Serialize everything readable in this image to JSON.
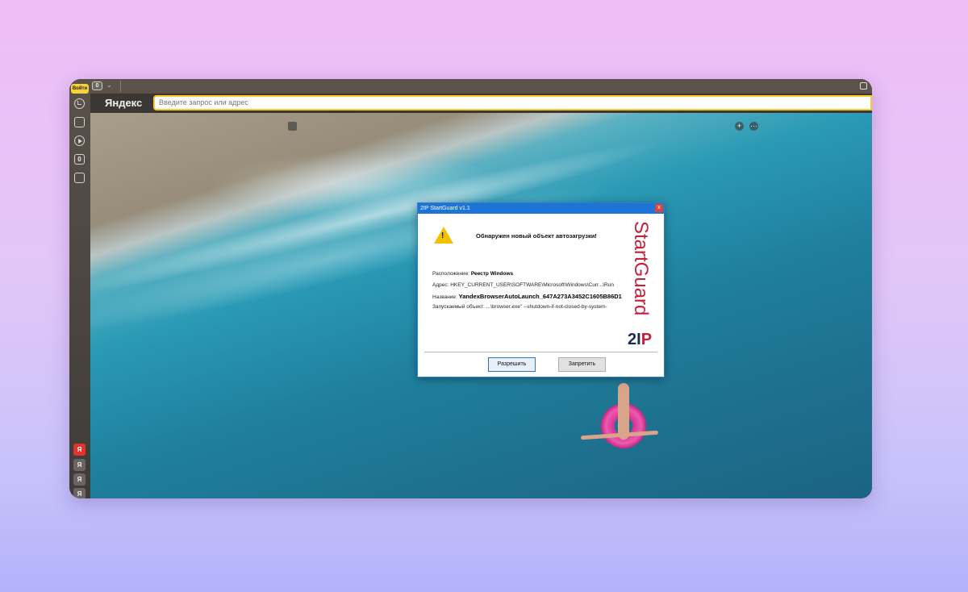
{
  "sidebar": {
    "login_label": "Войти",
    "icons": [
      "history-icon",
      "collections-icon",
      "video-icon",
      "counter-icon",
      "screenshot-icon"
    ],
    "counter_text": "0",
    "bottom_tabs": [
      "Я",
      "Я",
      "Я",
      "Я"
    ]
  },
  "tabstrip": {
    "tab_count": "0",
    "chevron": "⌄"
  },
  "addressbar": {
    "brand": "Яндекс",
    "placeholder": "Введите запрос или адрес"
  },
  "content": {
    "add_label": "+",
    "more_label": "···"
  },
  "dialog": {
    "title": "2IP StartGuard v1.1",
    "close_label": "x",
    "headline": "Обнаружен новый объект автозагрузки!",
    "location_label": "Расположение:",
    "location_value": "Реестр Windows",
    "address_label": "Адрес:",
    "address_value": "HKEY_CURRENT_USER\\SOFTWARE\\Microsoft\\Windows\\Curr...\\Run",
    "name_label": "Название:",
    "name_value": "YandexBrowserAutoLaunch_647A273A3452C1605B86D1",
    "exec_label": "Запускаемый объект:",
    "exec_value": "...\\browser.exe\" --shutdown-if-not-closed-by-system-",
    "brand_vertical": "StartGuard",
    "brand_logo_a": "2I",
    "brand_logo_b": "P",
    "allow_label": "Разрешить",
    "deny_label": "Запретить"
  },
  "colors": {
    "accent": "#1e74d6",
    "brand_red": "#c81e3a",
    "address_border": "#f7cc2c"
  }
}
